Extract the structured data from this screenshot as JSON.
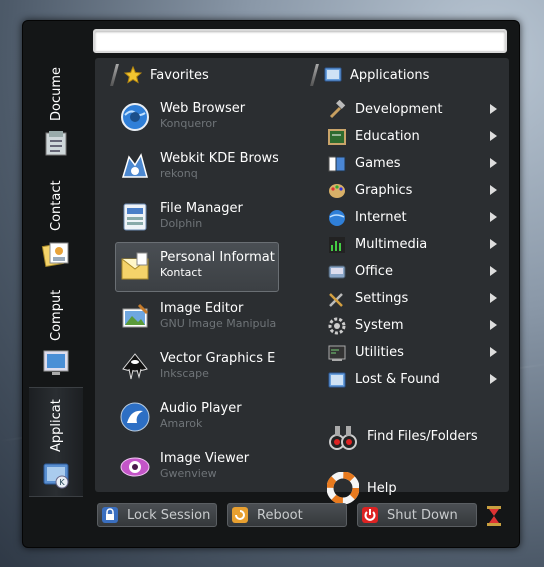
{
  "search": {
    "value": "",
    "placeholder": ""
  },
  "sidebar": {
    "tabs": [
      {
        "label": "Docume",
        "icon": "document-icon"
      },
      {
        "label": "Contact",
        "icon": "contacts-icon"
      },
      {
        "label": "Comput",
        "icon": "computer-icon"
      },
      {
        "label": "Applicat",
        "icon": "applications-icon"
      }
    ],
    "active": "Applicat"
  },
  "favorites": {
    "header": "Favorites",
    "items": [
      {
        "name": "Web Browser",
        "sub": "Konqueror",
        "icon": "globe-icon"
      },
      {
        "name": "Webkit KDE Brows",
        "sub": "rekonq",
        "icon": "rekonq-icon"
      },
      {
        "name": "File Manager",
        "sub": "Dolphin",
        "icon": "file-manager-icon"
      },
      {
        "name": "Personal Informat",
        "sub": "Kontact",
        "icon": "kontact-icon"
      },
      {
        "name": "Image Editor",
        "sub": "GNU Image Manipula",
        "icon": "image-editor-icon"
      },
      {
        "name": "Vector Graphics E",
        "sub": "Inkscape",
        "icon": "inkscape-icon"
      },
      {
        "name": "Audio Player",
        "sub": "Amarok",
        "icon": "amarok-icon"
      },
      {
        "name": "Image Viewer",
        "sub": "Gwenview",
        "icon": "gwenview-icon"
      }
    ]
  },
  "applications": {
    "header": "Applications",
    "categories": [
      {
        "label": "Development",
        "icon": "hammer-icon"
      },
      {
        "label": "Education",
        "icon": "education-icon"
      },
      {
        "label": "Games",
        "icon": "games-icon"
      },
      {
        "label": "Graphics",
        "icon": "palette-icon"
      },
      {
        "label": "Internet",
        "icon": "globe-icon"
      },
      {
        "label": "Multimedia",
        "icon": "multimedia-icon"
      },
      {
        "label": "Office",
        "icon": "office-icon"
      },
      {
        "label": "Settings",
        "icon": "settings-icon"
      },
      {
        "label": "System",
        "icon": "gear-icon"
      },
      {
        "label": "Utilities",
        "icon": "utilities-icon"
      },
      {
        "label": "Lost & Found",
        "icon": "lost-found-icon"
      }
    ],
    "find": "Find Files/Folders",
    "help": "Help"
  },
  "bottom": {
    "lock": "Lock Session",
    "reboot": "Reboot",
    "shutdown": "Shut Down"
  }
}
